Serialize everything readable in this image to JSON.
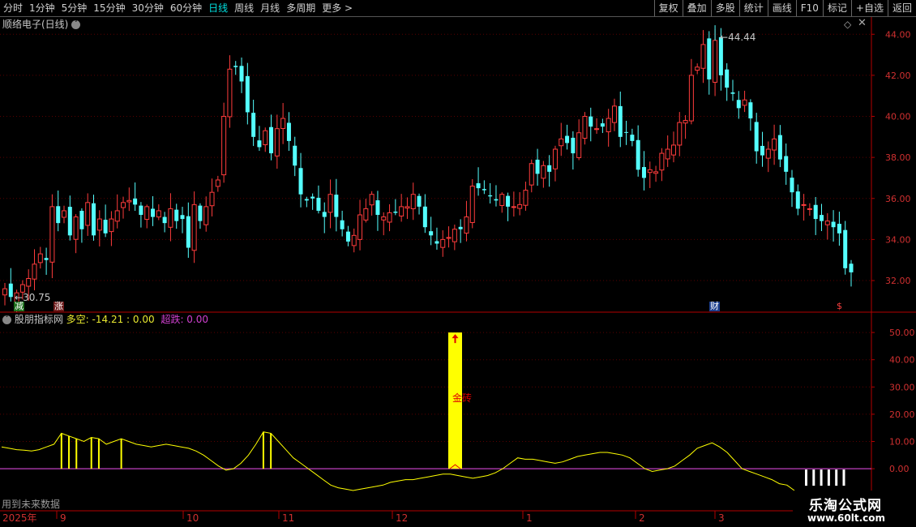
{
  "toolbar": {
    "periods": [
      "分时",
      "1分钟",
      "5分钟",
      "15分钟",
      "30分钟",
      "60分钟",
      "日线",
      "周线",
      "月线",
      "多周期",
      "更多 >"
    ],
    "active_index": 6,
    "buttons": [
      "复权",
      "叠加",
      "多股",
      "统计",
      "画线",
      "F10",
      "标记",
      "+自选",
      "返回"
    ]
  },
  "main_pane": {
    "title": "顺络电子(日线)",
    "high_label": "44.44",
    "low_label": "30.75",
    "markers": {
      "reduce": "减",
      "rise": "涨",
      "finance": "财",
      "dollar": "$"
    }
  },
  "indicator_pane": {
    "name": "股朋指标网",
    "values_text": "多空: -14.21 : 0.00",
    "super_text": "超跌: 0.00",
    "annotation": "金砖",
    "footer_note": "用到未来数据"
  },
  "time_axis": {
    "labels": [
      "2025年",
      "9",
      "10",
      "11",
      "12",
      "1",
      "2",
      "3"
    ]
  },
  "logo": {
    "name": "乐淘公式网",
    "url": "www.60lt.com"
  },
  "colors": {
    "up": "#ff3c3c",
    "down": "#54ffff",
    "axis": "#b40000",
    "signal": "#ffff00",
    "purple": "#c040c0"
  },
  "chart_data": [
    {
      "type": "candlestick",
      "title": "顺络电子(日线)",
      "ylim": [
        30.5,
        44.8
      ],
      "yticks": [
        32.0,
        34.0,
        36.0,
        38.0,
        40.0,
        42.0,
        44.0
      ],
      "close": [
        31.6,
        31.2,
        31.4,
        31.8,
        32.1,
        32.8,
        33.3,
        33.0,
        35.6,
        34.8,
        35.4,
        34.2,
        35.1,
        34.5,
        35.8,
        34.2,
        35.0,
        34.3,
        35.0,
        35.4,
        35.8,
        35.9,
        35.7,
        35.2,
        35.6,
        35.1,
        35.4,
        34.8,
        35.5,
        34.9,
        35.0,
        33.6,
        35.7,
        34.9,
        35.6,
        36.3,
        36.9,
        40.0,
        42.3,
        42.4,
        41.7,
        40.2,
        39.0,
        38.5,
        39.3,
        38.2,
        39.4,
        39.9,
        38.8,
        37.6,
        36.2,
        35.9,
        36.0,
        35.4,
        35.1,
        36.2,
        35.1,
        34.5,
        33.9,
        34.2,
        35.2,
        35.5,
        36.2,
        35.2,
        35.1,
        35.3,
        35.3,
        35.6,
        35.6,
        36.2,
        35.6,
        34.6,
        34.2,
        33.8,
        34.0,
        34.1,
        34.5,
        34.5,
        35.1,
        36.6,
        36.5,
        36.4,
        36.1,
        35.9,
        36.2,
        35.6,
        35.6,
        35.7,
        36.4,
        37.7,
        37.2,
        37.6,
        37.3,
        38.4,
        38.9,
        38.7,
        38.2,
        39.2,
        40.0,
        39.5,
        39.4,
        39.5,
        39.9,
        40.5,
        39.0,
        39.2,
        38.8,
        37.4,
        37.0,
        37.4,
        37.3,
        38.2,
        38.4,
        38.6,
        39.7,
        39.8,
        42.0,
        42.4,
        43.5,
        41.8,
        43.7,
        42.0,
        41.4,
        41.1,
        40.4,
        40.8,
        39.9,
        38.3,
        38.1,
        38.4,
        38.9,
        37.9,
        37.3,
        36.3,
        35.5,
        35.7,
        35.5,
        35.0,
        34.9,
        34.9,
        34.6,
        34.3,
        32.6,
        32.4
      ],
      "high_marker": 44.44,
      "low_marker": 30.75
    },
    {
      "type": "line",
      "title": "股朋指标网",
      "ylim": [
        -8,
        53
      ],
      "yticks": [
        0.0,
        10.0,
        20.0,
        30.0,
        40.0,
        50.0
      ],
      "series": [
        {
          "name": "多空",
          "values": [
            8,
            7.5,
            7,
            6.8,
            6.5,
            7,
            8,
            9,
            13,
            12,
            11,
            10,
            11.5,
            11,
            9,
            10,
            11,
            10,
            9,
            8.5,
            8,
            8.5,
            9,
            8.5,
            8,
            7.5,
            6.5,
            5,
            3,
            1,
            -0.5,
            0,
            2,
            5,
            9,
            13.5,
            13,
            10,
            7,
            4,
            2,
            0,
            -2,
            -4,
            -6,
            -7,
            -7.5,
            -8,
            -7.5,
            -7,
            -6.5,
            -6,
            -5,
            -4.5,
            -4,
            -4,
            -3.5,
            -3,
            -2.5,
            -2,
            -2,
            -2.5,
            -3,
            -3.5,
            -3,
            -2.5,
            -1.5,
            0,
            2,
            4,
            3.5,
            3.5,
            3,
            2.5,
            2,
            2.5,
            3.5,
            4.5,
            5,
            5.5,
            6,
            6,
            5.5,
            5,
            4,
            2,
            0,
            -1,
            -0.5,
            0,
            1,
            3,
            5,
            7.5,
            8.5,
            9.5,
            8,
            6,
            3,
            0,
            -1,
            -2,
            -3,
            -4,
            -5.5,
            -6,
            -8
          ]
        }
      ],
      "signal_bars_index": [
        69,
        70,
        71,
        72,
        73,
        74
      ],
      "big_bar": {
        "value": 50,
        "label": "金砖"
      },
      "overlay": "多空: -14.21 : 0.00",
      "super": 0.0
    }
  ]
}
